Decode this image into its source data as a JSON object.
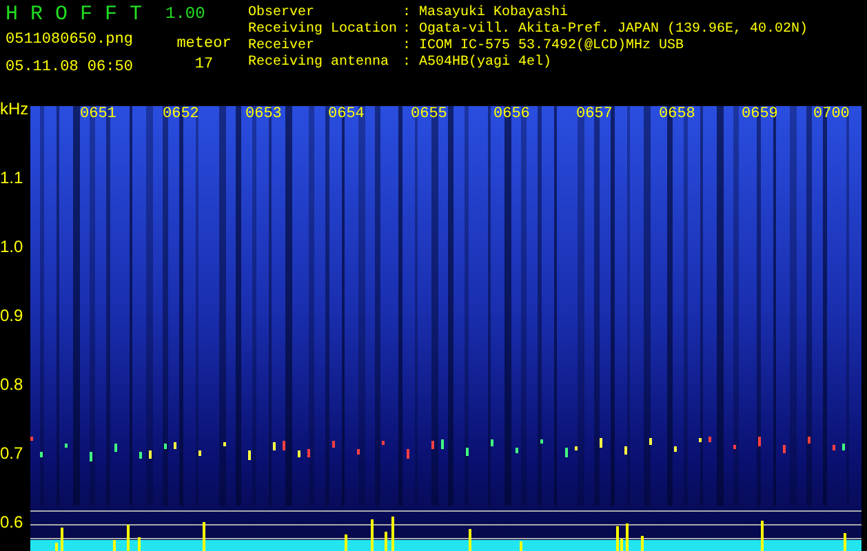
{
  "app": {
    "name": "H R O F F T",
    "version": "1.00"
  },
  "file": {
    "filename": "0511080650.png",
    "datetime": "05.11.08 06:50"
  },
  "meteor": {
    "label": "meteor",
    "count": "17"
  },
  "info": [
    {
      "label": "Observer",
      "separator": ":",
      "value": "Masayuki Kobayashi"
    },
    {
      "label": "Receiving Location",
      "separator": ":",
      "value": "Ogata-vill. Akita-Pref. JAPAN (139.96E, 40.02N)"
    },
    {
      "label": "Receiver",
      "separator": ":",
      "value": "ICOM IC-575 53.7492(@LCD)MHz USB"
    },
    {
      "label": "Receiving antenna",
      "separator": ":",
      "value": "A504HB(yagi 4el)"
    }
  ],
  "axis": {
    "unit": "kHz",
    "ticks": [
      "1.1",
      "1.0",
      "0.9",
      "0.8",
      "0.7",
      "0.6"
    ]
  },
  "times": [
    "0651",
    "0652",
    "0653",
    "0654",
    "0655",
    "0656",
    "0657",
    "0658",
    "0659",
    "0700"
  ]
}
